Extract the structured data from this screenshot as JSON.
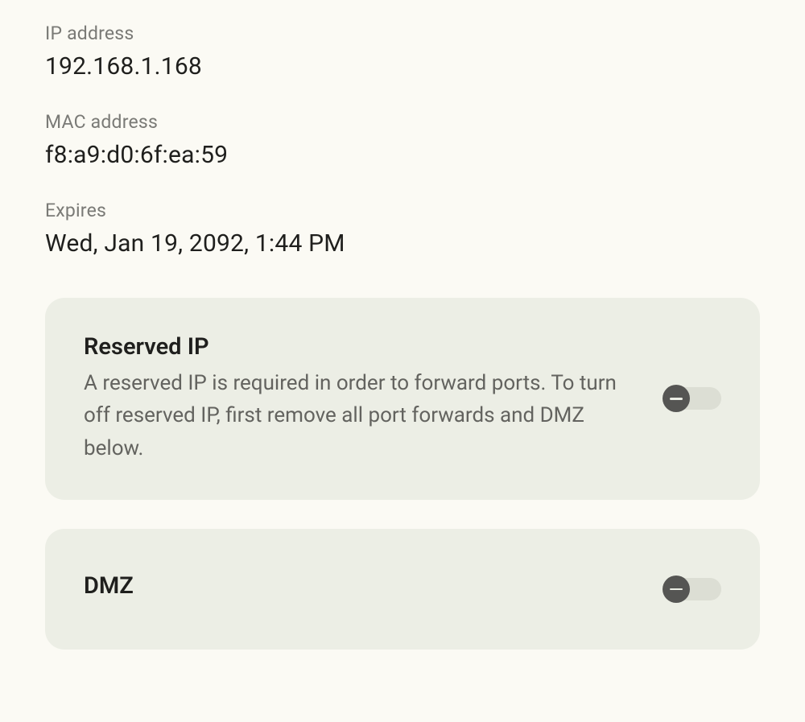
{
  "fields": {
    "ip_label": "IP address",
    "ip_value": "192.168.1.168",
    "mac_label": "MAC address",
    "mac_value": "f8:a9:d0:6f:ea:59",
    "expires_label": "Expires",
    "expires_value": "Wed, Jan 19, 2092, 1:44 PM"
  },
  "cards": {
    "reserved_ip": {
      "title": "Reserved IP",
      "desc": "A reserved IP is required in order to forward ports. To turn off reserved IP, first remove all port forwards and DMZ below.",
      "toggle_on": false,
      "toggle_disabled": true
    },
    "dmz": {
      "title": "DMZ",
      "toggle_on": false,
      "toggle_disabled": true
    }
  }
}
